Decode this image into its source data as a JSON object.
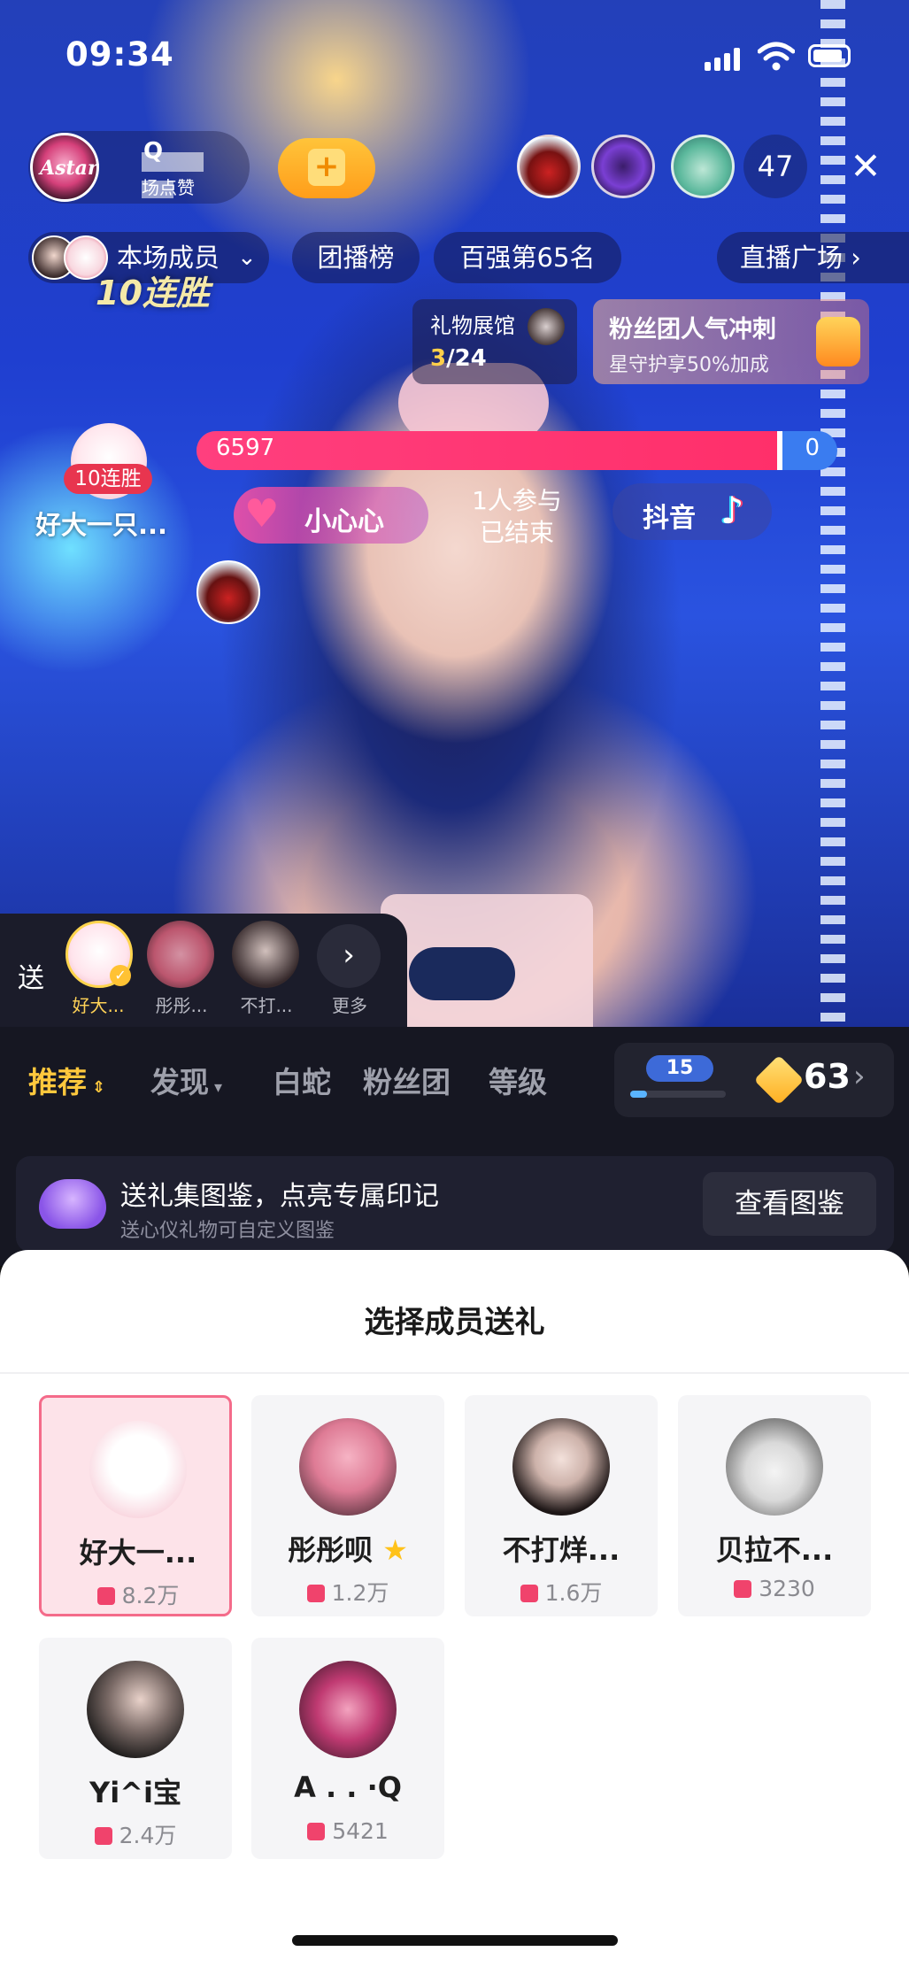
{
  "status_bar": {
    "time": "09:34"
  },
  "host": {
    "avatar_text": "Astar",
    "name_suffix": "Q",
    "likes_suffix": "场点赞"
  },
  "viewers": {
    "count": "47"
  },
  "chips": {
    "members": "本场成员",
    "tuanbo": "团播榜",
    "rank": "百强第65名",
    "plaza": "直播广场"
  },
  "stream": {
    "banner_streak": "10连胜",
    "gift_hall": {
      "title": "礼物展馆",
      "progress_current": "3",
      "progress_total": "/24"
    },
    "fan_club": {
      "title": "粉丝团人气冲刺",
      "subtitle": "星守护享50%加成"
    },
    "pk": {
      "left_score": "6597",
      "right_score": "0"
    },
    "gift_streak_badge": "10连胜",
    "gift_sender": "好大一只...",
    "gift_name": "小心心",
    "participation": "1人参与\n已结束",
    "douyin": "抖音"
  },
  "send_strip": {
    "label": "送",
    "recipients": [
      "好大...",
      "彤彤...",
      "不打..."
    ],
    "more": "更多"
  },
  "gift_panel": {
    "tabs": [
      "推荐",
      "发现",
      "白蛇",
      "粉丝团",
      "等级"
    ],
    "gem_level": "15",
    "gem_progress": 0.18,
    "coins": "63",
    "collection": {
      "title": "送礼集图鉴，点亮专属印记",
      "subtitle": "送心仪礼物可自定义图鉴",
      "button": "查看图鉴"
    }
  },
  "member_sheet": {
    "title": "选择成员送礼",
    "members": [
      {
        "name": "好大一...",
        "gifts": "8.2万"
      },
      {
        "name": "彤彤呗",
        "gifts": "1.2万"
      },
      {
        "name": "不打烊...",
        "gifts": "1.6万"
      },
      {
        "name": "贝拉不...",
        "gifts": "3230"
      },
      {
        "name": "Yi^i宝",
        "gifts": "2.4万"
      },
      {
        "name": "A . . ·Q",
        "gifts": "5421"
      }
    ],
    "selected_index": 0
  },
  "colors": {
    "accent_gold": "#ffc83d",
    "pk_red": "#ff2f6a",
    "pk_blue": "#3a7cf0",
    "selected_border": "#f46b8a"
  }
}
